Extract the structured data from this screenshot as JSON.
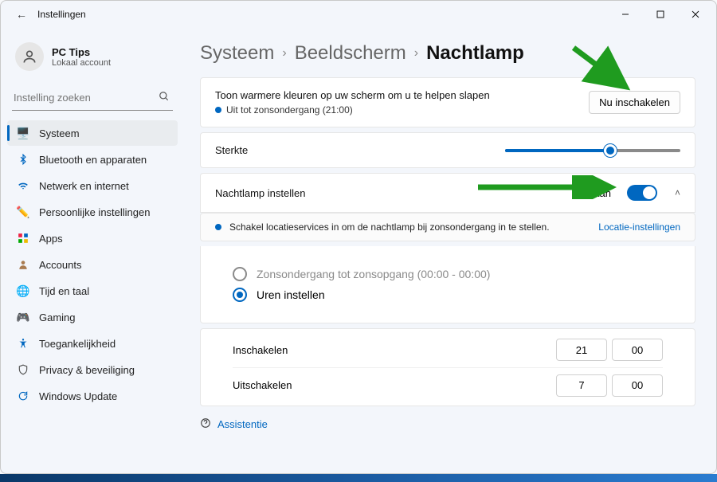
{
  "window": {
    "title": "Instellingen"
  },
  "profile": {
    "name": "PC Tips",
    "sub": "Lokaal account"
  },
  "search": {
    "placeholder": "Instelling zoeken"
  },
  "sidebar": {
    "items": [
      {
        "label": "Systeem"
      },
      {
        "label": "Bluetooth en apparaten"
      },
      {
        "label": "Netwerk en internet"
      },
      {
        "label": "Persoonlijke instellingen"
      },
      {
        "label": "Apps"
      },
      {
        "label": "Accounts"
      },
      {
        "label": "Tijd en taal"
      },
      {
        "label": "Gaming"
      },
      {
        "label": "Toegankelijkheid"
      },
      {
        "label": "Privacy & beveiliging"
      },
      {
        "label": "Windows Update"
      }
    ]
  },
  "breadcrumb": {
    "l1": "Systeem",
    "l2": "Beeldscherm",
    "current": "Nachtlamp"
  },
  "colors": {
    "accent": "#0067c0",
    "arrow": "#1f9b1f"
  },
  "top_card": {
    "desc": "Toon warmere kleuren op uw scherm om u te helpen slapen",
    "status": "Uit tot zonsondergang (21:00)",
    "button": "Nu inschakelen"
  },
  "strength": {
    "label": "Sterkte",
    "pct": 60
  },
  "schedule": {
    "label": "Nachtlamp instellen",
    "state": "Aan"
  },
  "info": {
    "text": "Schakel locatieservices in om de nachtlamp bij zonsondergang in te stellen.",
    "link": "Locatie-instellingen"
  },
  "radios": {
    "opt1": "Zonsondergang tot zonsopgang (00:00 - 00:00)",
    "opt2": "Uren instellen"
  },
  "hours": {
    "on_label": "Inschakelen",
    "on_h": "21",
    "on_m": "00",
    "off_label": "Uitschakelen",
    "off_h": "7",
    "off_m": "00"
  },
  "assist": {
    "label": "Assistentie"
  }
}
